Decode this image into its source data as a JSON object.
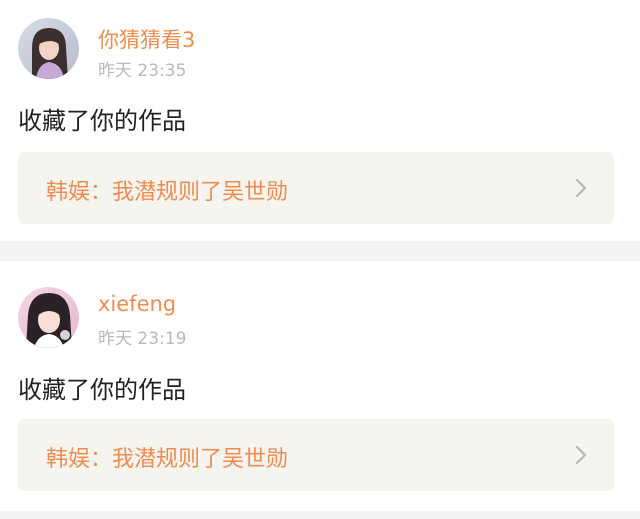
{
  "notifications": [
    {
      "username": "你猜猜看3",
      "timestamp": "昨天 23:35",
      "action": "收藏了你的作品",
      "work_title": "韩娱：我潜规则了吴世勋",
      "avatar_icon": "avatar-girl-long-hair"
    },
    {
      "username": "xiefeng",
      "timestamp": "昨天 23:19",
      "action": "收藏了你的作品",
      "work_title": "韩娱：我潜规则了吴世勋",
      "avatar_icon": "avatar-girl-bangs"
    }
  ],
  "colors": {
    "accent": "#f08c50",
    "timestamp": "#b9b9b9",
    "link_bg": "#f5f4ef",
    "separator": "#f3f3f3"
  }
}
